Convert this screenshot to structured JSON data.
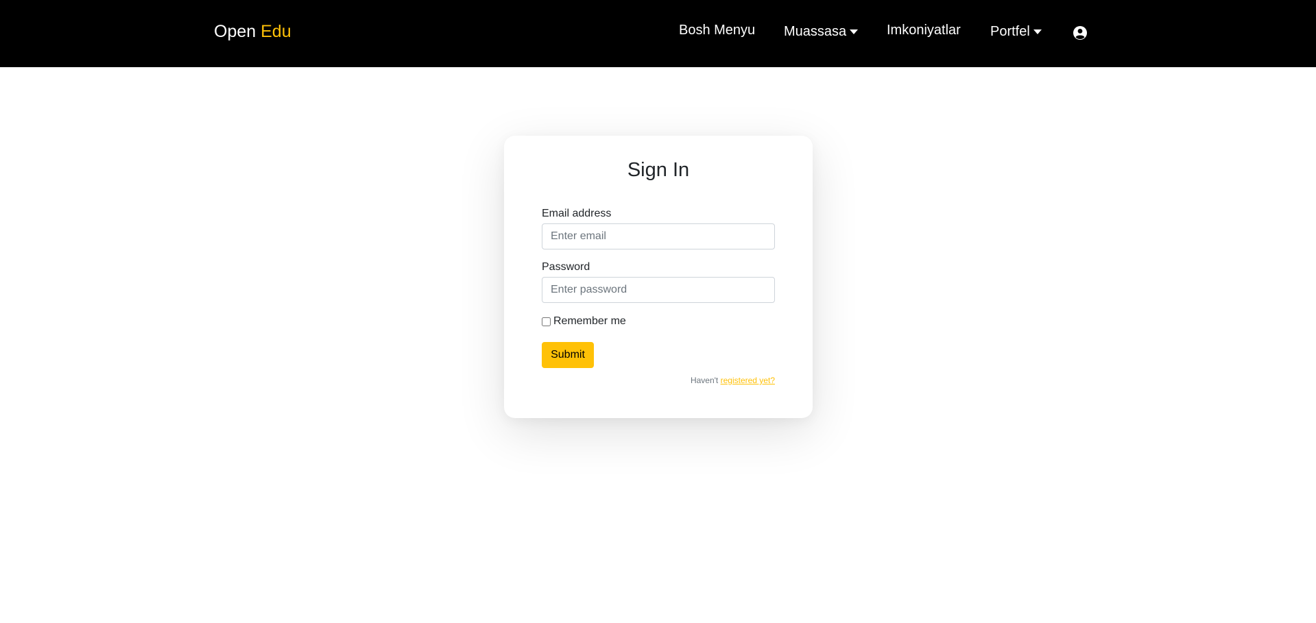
{
  "navbar": {
    "brand_first": "Open",
    "brand_second": "Edu",
    "accent_color": "#ffc107",
    "items": [
      {
        "label": "Bosh Menyu",
        "dropdown": false
      },
      {
        "label": "Muassasa",
        "dropdown": true
      },
      {
        "label": "Imkoniyatlar",
        "dropdown": false
      },
      {
        "label": "Portfel",
        "dropdown": true
      }
    ],
    "user_icon": "user-circle-icon"
  },
  "signin": {
    "title": "Sign In",
    "email_label": "Email address",
    "email_placeholder": "Enter email",
    "email_value": "",
    "password_label": "Password",
    "password_placeholder": "Enter password",
    "password_value": "",
    "remember_label": "Remember me",
    "remember_checked": false,
    "submit_label": "Submit",
    "register_prefix": "Haven't",
    "register_link": "registered yet?"
  }
}
